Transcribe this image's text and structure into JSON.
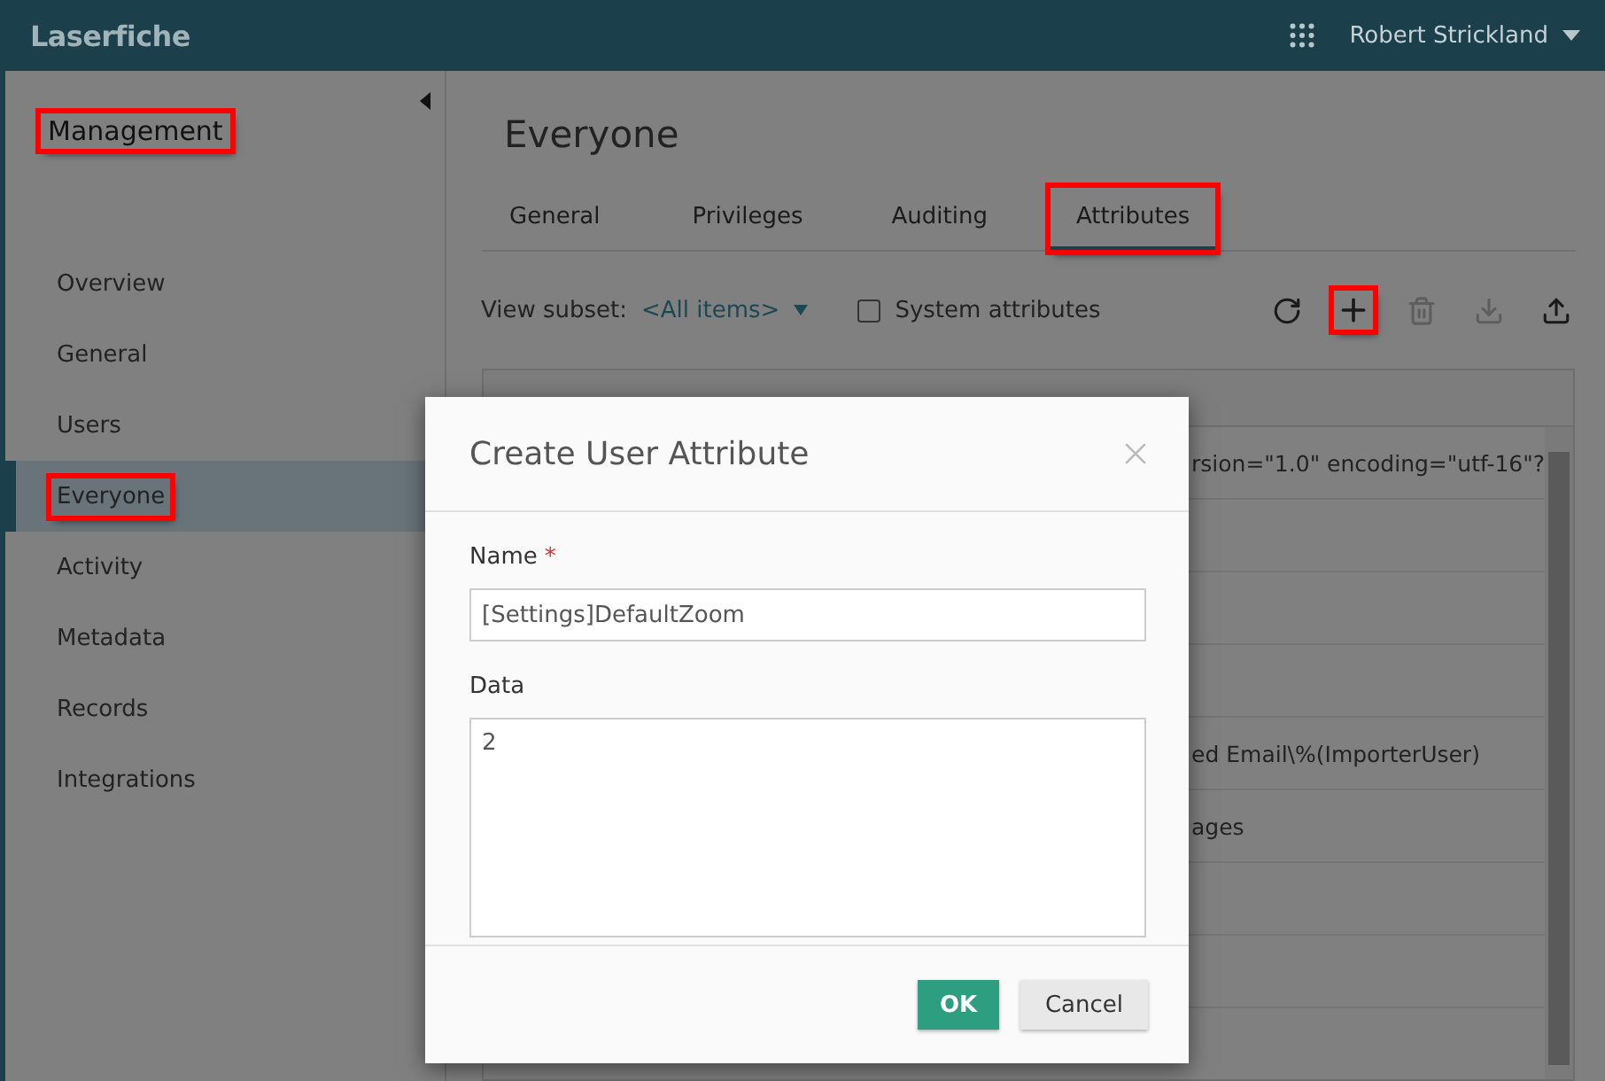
{
  "header": {
    "logo": "Laserfiche",
    "user_name": "Robert Strickland"
  },
  "sidebar": {
    "title": "Management",
    "title_highlighted": true,
    "items": [
      {
        "label": "Overview",
        "selected": false,
        "highlighted": false
      },
      {
        "label": "General",
        "selected": false,
        "highlighted": false
      },
      {
        "label": "Users",
        "selected": false,
        "highlighted": false
      },
      {
        "label": "Everyone",
        "selected": true,
        "highlighted": true
      },
      {
        "label": "Activity",
        "selected": false,
        "highlighted": false
      },
      {
        "label": "Metadata",
        "selected": false,
        "highlighted": false
      },
      {
        "label": "Records",
        "selected": false,
        "highlighted": false
      },
      {
        "label": "Integrations",
        "selected": false,
        "highlighted": false
      }
    ]
  },
  "page": {
    "title": "Everyone",
    "tabs": [
      {
        "label": "General",
        "selected": false,
        "highlighted": false
      },
      {
        "label": "Privileges",
        "selected": false,
        "highlighted": false
      },
      {
        "label": "Auditing",
        "selected": false,
        "highlighted": false
      },
      {
        "label": "Attributes",
        "selected": true,
        "highlighted": true
      }
    ],
    "toolbar": {
      "view_subset_label": "View subset:",
      "subset_value": "<All items>",
      "system_attributes": {
        "label": "System attributes",
        "checked": false
      },
      "actions": [
        {
          "kind": "refresh",
          "disabled": false,
          "highlighted": false
        },
        {
          "kind": "add",
          "disabled": false,
          "highlighted": true
        },
        {
          "kind": "delete",
          "disabled": true,
          "highlighted": false
        },
        {
          "kind": "export",
          "disabled": true,
          "highlighted": false
        },
        {
          "kind": "import",
          "disabled": false,
          "highlighted": false
        }
      ]
    },
    "table": {
      "rows": [
        {
          "column_2": "rsion=\"1.0\" encoding=\"utf-16\"?"
        },
        {},
        {},
        {},
        {
          "column_2": "ed Email\\%(ImporterUser)"
        },
        {
          "column_2": "ages"
        },
        {},
        {}
      ]
    }
  },
  "dialog": {
    "title": "Create User Attribute",
    "name_label": "Name",
    "required_mark": "*",
    "name_value": "[Settings]DefaultZoom",
    "data_label": "Data",
    "data_value": "2",
    "ok": "OK",
    "cancel": "Cancel"
  }
}
